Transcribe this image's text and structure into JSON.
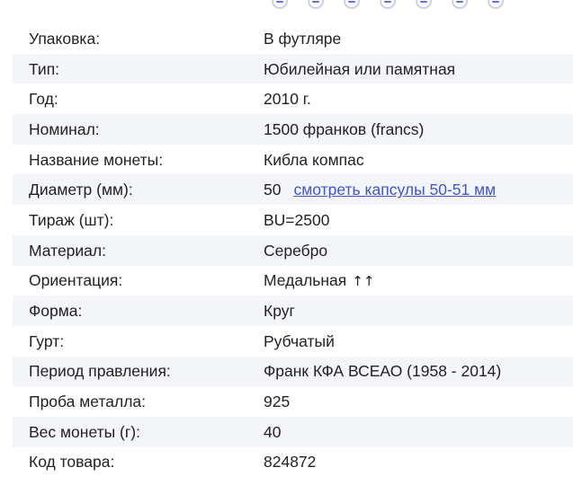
{
  "specs": [
    {
      "label": "Упаковка:",
      "value": "В футляре"
    },
    {
      "label": "Тип:",
      "value": "Юбилейная или памятная"
    },
    {
      "label": "Год:",
      "value": "2010 г."
    },
    {
      "label": "Номинал:",
      "value": "1500 франков (francs)"
    },
    {
      "label": "Название монеты:",
      "value": "Кибла компас"
    },
    {
      "label": "Диаметр (мм):",
      "value": "50",
      "link": "смотреть капсулы 50-51 мм"
    },
    {
      "label": "Тираж (шт):",
      "value": "BU=2500"
    },
    {
      "label": "Материал:",
      "value": "Серебро"
    },
    {
      "label": "Ориентация:",
      "value": "Медальная",
      "arrows": "↑↑"
    },
    {
      "label": "Форма:",
      "value": "Круг"
    },
    {
      "label": "Гурт:",
      "value": "Рубчатый"
    },
    {
      "label": "Период правления:",
      "value": "Франк КФА ВСЕАО (1958 - 2014)"
    },
    {
      "label": "Проба металла:",
      "value": "925"
    },
    {
      "label": "Вес монеты (г):",
      "value": "40"
    },
    {
      "label": "Код товара:",
      "value": "824872"
    }
  ],
  "icons": {
    "top_dots": "carousel-dot-icon",
    "orientation": "up-arrows-icon"
  },
  "colors": {
    "link": "#3f57c7",
    "row_stripe": "#f4f5f9",
    "dot_border": "#c6cff1"
  }
}
